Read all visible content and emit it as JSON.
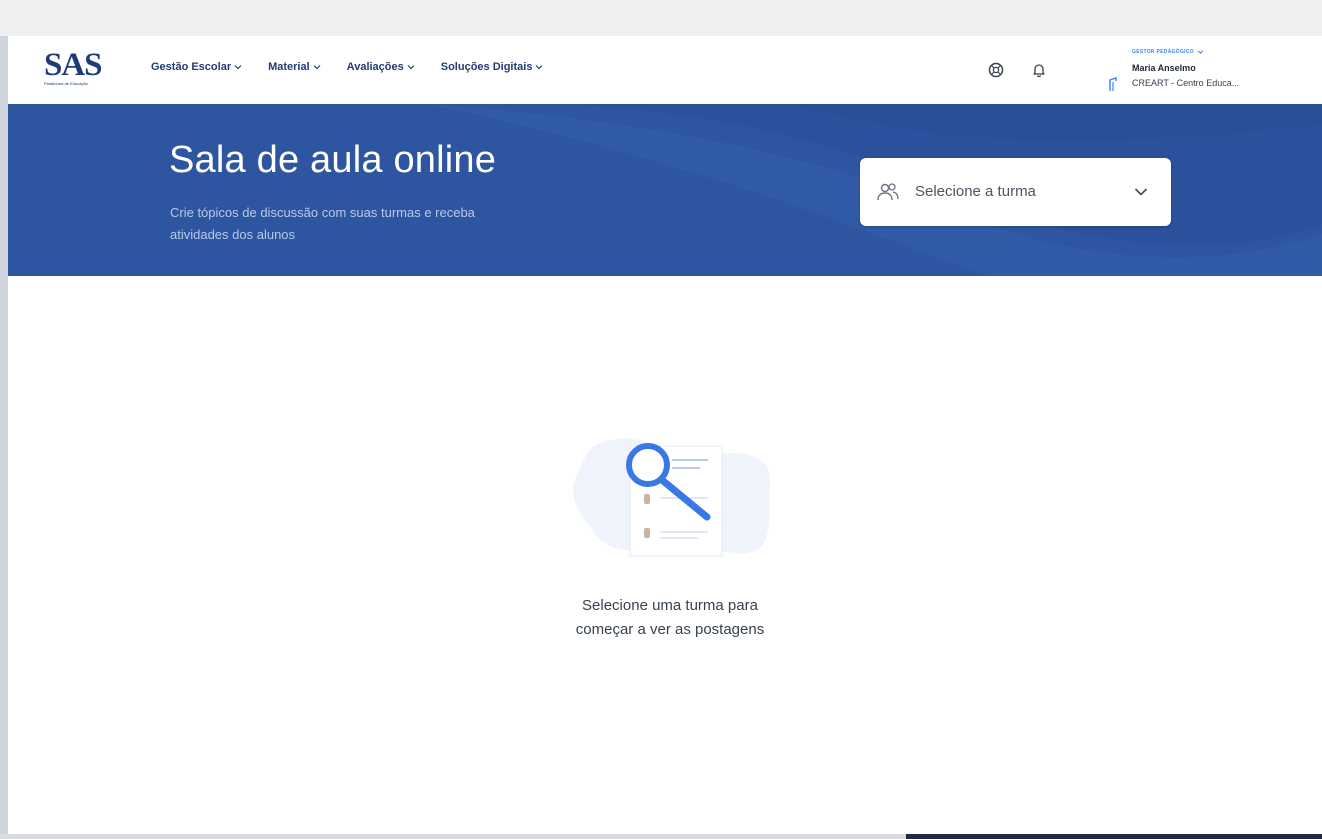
{
  "header": {
    "logo": "SAS",
    "logo_sub": "Plataforma de Educação",
    "nav": [
      {
        "label": "Gestão Escolar"
      },
      {
        "label": "Material"
      },
      {
        "label": "Avaliações"
      },
      {
        "label": "Soluções Digitais"
      }
    ],
    "profile": {
      "role": "GESTOR PEDAGÓGICO",
      "name": "Maria Anselmo",
      "school": "CREART - Centro Educa..."
    }
  },
  "banner": {
    "title": "Sala de aula online",
    "subtitle": "Crie tópicos de discussão com suas turmas e receba atividades dos alunos",
    "select_placeholder": "Selecione a turma"
  },
  "empty_state": {
    "line1": "Selecione uma turma para",
    "line2": "começar a ver as postagens"
  },
  "colors": {
    "banner": "#2b519c",
    "nav_text": "#233a73",
    "accent": "#3b82f6"
  },
  "icons": {
    "header_help": "help-icon",
    "header_bell": "bell-icon",
    "select_users": "users-icon",
    "select_chevron": "chevron-down-icon",
    "empty": "magnifier-document-illustration"
  }
}
